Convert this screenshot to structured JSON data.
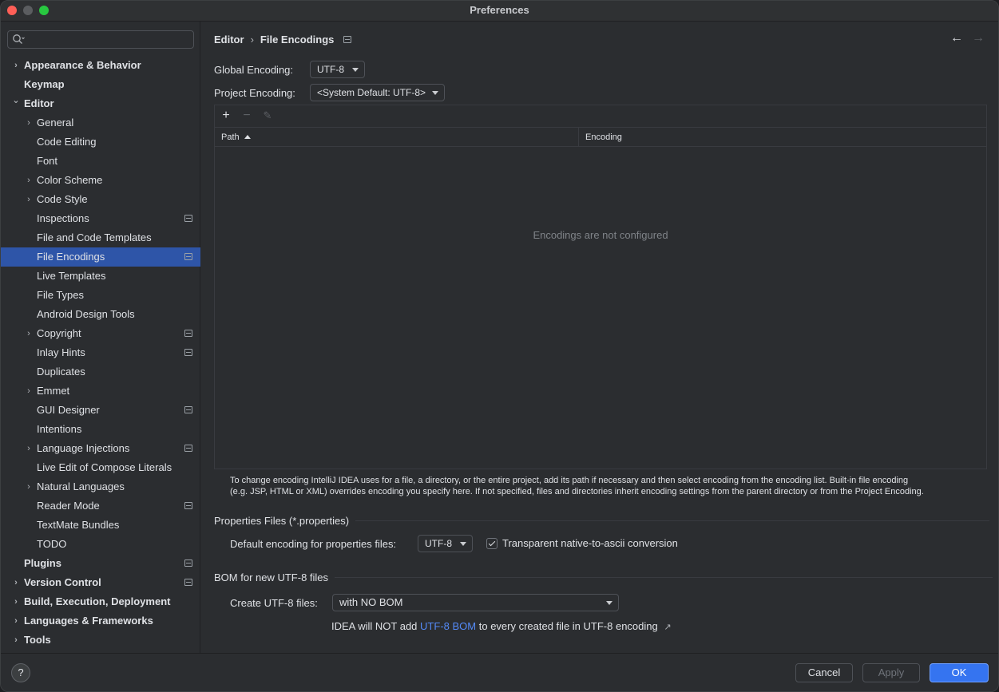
{
  "window": {
    "title": "Preferences"
  },
  "search": {
    "placeholder": ""
  },
  "sidebar": {
    "items": [
      {
        "label": "Appearance & Behavior",
        "bold": true,
        "level": 0,
        "chevron": true,
        "proj": false
      },
      {
        "label": "Keymap",
        "bold": true,
        "level": 0,
        "chevron": false,
        "proj": false
      },
      {
        "label": "Editor",
        "bold": true,
        "level": 0,
        "chevron": "open",
        "proj": false
      },
      {
        "label": "General",
        "bold": false,
        "level": 1,
        "chevron": true,
        "proj": false
      },
      {
        "label": "Code Editing",
        "bold": false,
        "level": 1,
        "chevron": false,
        "proj": false
      },
      {
        "label": "Font",
        "bold": false,
        "level": 1,
        "chevron": false,
        "proj": false
      },
      {
        "label": "Color Scheme",
        "bold": false,
        "level": 1,
        "chevron": true,
        "proj": false
      },
      {
        "label": "Code Style",
        "bold": false,
        "level": 1,
        "chevron": true,
        "proj": false
      },
      {
        "label": "Inspections",
        "bold": false,
        "level": 1,
        "chevron": false,
        "proj": true
      },
      {
        "label": "File and Code Templates",
        "bold": false,
        "level": 1,
        "chevron": false,
        "proj": false
      },
      {
        "label": "File Encodings",
        "bold": false,
        "level": 1,
        "chevron": false,
        "proj": true,
        "selected": true
      },
      {
        "label": "Live Templates",
        "bold": false,
        "level": 1,
        "chevron": false,
        "proj": false
      },
      {
        "label": "File Types",
        "bold": false,
        "level": 1,
        "chevron": false,
        "proj": false
      },
      {
        "label": "Android Design Tools",
        "bold": false,
        "level": 1,
        "chevron": false,
        "proj": false
      },
      {
        "label": "Copyright",
        "bold": false,
        "level": 1,
        "chevron": true,
        "proj": true
      },
      {
        "label": "Inlay Hints",
        "bold": false,
        "level": 1,
        "chevron": false,
        "proj": true
      },
      {
        "label": "Duplicates",
        "bold": false,
        "level": 1,
        "chevron": false,
        "proj": false
      },
      {
        "label": "Emmet",
        "bold": false,
        "level": 1,
        "chevron": true,
        "proj": false
      },
      {
        "label": "GUI Designer",
        "bold": false,
        "level": 1,
        "chevron": false,
        "proj": true
      },
      {
        "label": "Intentions",
        "bold": false,
        "level": 1,
        "chevron": false,
        "proj": false
      },
      {
        "label": "Language Injections",
        "bold": false,
        "level": 1,
        "chevron": true,
        "proj": true
      },
      {
        "label": "Live Edit of Compose Literals",
        "bold": false,
        "level": 1,
        "chevron": false,
        "proj": false
      },
      {
        "label": "Natural Languages",
        "bold": false,
        "level": 1,
        "chevron": true,
        "proj": false
      },
      {
        "label": "Reader Mode",
        "bold": false,
        "level": 1,
        "chevron": false,
        "proj": true
      },
      {
        "label": "TextMate Bundles",
        "bold": false,
        "level": 1,
        "chevron": false,
        "proj": false
      },
      {
        "label": "TODO",
        "bold": false,
        "level": 1,
        "chevron": false,
        "proj": false
      },
      {
        "label": "Plugins",
        "bold": true,
        "level": 0,
        "chevron": false,
        "proj": true
      },
      {
        "label": "Version Control",
        "bold": true,
        "level": 0,
        "chevron": true,
        "proj": true
      },
      {
        "label": "Build, Execution, Deployment",
        "bold": true,
        "level": 0,
        "chevron": true,
        "proj": false
      },
      {
        "label": "Languages & Frameworks",
        "bold": true,
        "level": 0,
        "chevron": true,
        "proj": false
      },
      {
        "label": "Tools",
        "bold": true,
        "level": 0,
        "chevron": true,
        "proj": false
      }
    ]
  },
  "breadcrumb": {
    "parent": "Editor",
    "separator": "›",
    "current": "File Encodings"
  },
  "nav": {
    "back": "←",
    "forward": "→"
  },
  "global_encoding": {
    "label": "Global Encoding:",
    "value": "UTF-8"
  },
  "project_encoding": {
    "label": "Project Encoding:",
    "value": "<System Default: UTF-8>"
  },
  "table": {
    "toolbar": {
      "add": "+",
      "remove": "−",
      "edit": "✎"
    },
    "columns": [
      "Path",
      "Encoding"
    ],
    "empty_text": "Encodings are not configured"
  },
  "help_text": {
    "line1": "To change encoding IntelliJ IDEA uses for a file, a directory, or the entire project, add its path if necessary and then select encoding from the encoding list. Built-in file encoding",
    "line2": "(e.g. JSP, HTML or XML) overrides encoding you specify here. If not specified, files and directories inherit encoding settings from the parent directory or from the Project Encoding."
  },
  "properties": {
    "section_title": "Properties Files (*.properties)",
    "default_label": "Default encoding for properties files:",
    "default_value": "UTF-8",
    "transparent_label": "Transparent native-to-ascii conversion",
    "transparent_checked": true
  },
  "bom": {
    "section_title": "BOM for new UTF-8 files",
    "create_label": "Create UTF-8 files:",
    "create_value": "with NO BOM",
    "note_prefix": "IDEA will NOT add",
    "note_link": "UTF-8 BOM",
    "note_suffix": "to every created file in UTF-8 encoding",
    "note_ext": "↗"
  },
  "footer": {
    "help": "?",
    "cancel": "Cancel",
    "apply": "Apply",
    "ok": "OK"
  },
  "colors": {
    "accent": "#3574f0",
    "selection": "#2e55a8",
    "link": "#548af7"
  }
}
